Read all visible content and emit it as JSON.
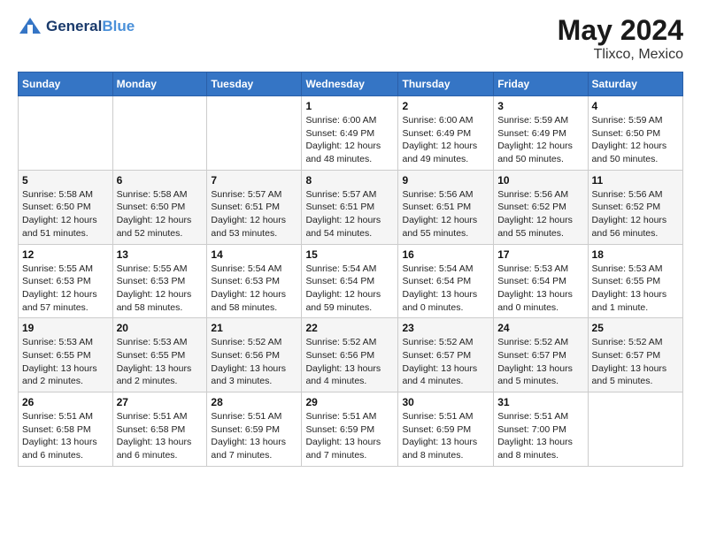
{
  "header": {
    "logo_line1": "General",
    "logo_line2": "Blue",
    "title": "May 2024",
    "subtitle": "Tlixco, Mexico"
  },
  "weekdays": [
    "Sunday",
    "Monday",
    "Tuesday",
    "Wednesday",
    "Thursday",
    "Friday",
    "Saturday"
  ],
  "weeks": [
    [
      {
        "day": "",
        "info": ""
      },
      {
        "day": "",
        "info": ""
      },
      {
        "day": "",
        "info": ""
      },
      {
        "day": "1",
        "info": "Sunrise: 6:00 AM\nSunset: 6:49 PM\nDaylight: 12 hours\nand 48 minutes."
      },
      {
        "day": "2",
        "info": "Sunrise: 6:00 AM\nSunset: 6:49 PM\nDaylight: 12 hours\nand 49 minutes."
      },
      {
        "day": "3",
        "info": "Sunrise: 5:59 AM\nSunset: 6:49 PM\nDaylight: 12 hours\nand 50 minutes."
      },
      {
        "day": "4",
        "info": "Sunrise: 5:59 AM\nSunset: 6:50 PM\nDaylight: 12 hours\nand 50 minutes."
      }
    ],
    [
      {
        "day": "5",
        "info": "Sunrise: 5:58 AM\nSunset: 6:50 PM\nDaylight: 12 hours\nand 51 minutes."
      },
      {
        "day": "6",
        "info": "Sunrise: 5:58 AM\nSunset: 6:50 PM\nDaylight: 12 hours\nand 52 minutes."
      },
      {
        "day": "7",
        "info": "Sunrise: 5:57 AM\nSunset: 6:51 PM\nDaylight: 12 hours\nand 53 minutes."
      },
      {
        "day": "8",
        "info": "Sunrise: 5:57 AM\nSunset: 6:51 PM\nDaylight: 12 hours\nand 54 minutes."
      },
      {
        "day": "9",
        "info": "Sunrise: 5:56 AM\nSunset: 6:51 PM\nDaylight: 12 hours\nand 55 minutes."
      },
      {
        "day": "10",
        "info": "Sunrise: 5:56 AM\nSunset: 6:52 PM\nDaylight: 12 hours\nand 55 minutes."
      },
      {
        "day": "11",
        "info": "Sunrise: 5:56 AM\nSunset: 6:52 PM\nDaylight: 12 hours\nand 56 minutes."
      }
    ],
    [
      {
        "day": "12",
        "info": "Sunrise: 5:55 AM\nSunset: 6:53 PM\nDaylight: 12 hours\nand 57 minutes."
      },
      {
        "day": "13",
        "info": "Sunrise: 5:55 AM\nSunset: 6:53 PM\nDaylight: 12 hours\nand 58 minutes."
      },
      {
        "day": "14",
        "info": "Sunrise: 5:54 AM\nSunset: 6:53 PM\nDaylight: 12 hours\nand 58 minutes."
      },
      {
        "day": "15",
        "info": "Sunrise: 5:54 AM\nSunset: 6:54 PM\nDaylight: 12 hours\nand 59 minutes."
      },
      {
        "day": "16",
        "info": "Sunrise: 5:54 AM\nSunset: 6:54 PM\nDaylight: 13 hours\nand 0 minutes."
      },
      {
        "day": "17",
        "info": "Sunrise: 5:53 AM\nSunset: 6:54 PM\nDaylight: 13 hours\nand 0 minutes."
      },
      {
        "day": "18",
        "info": "Sunrise: 5:53 AM\nSunset: 6:55 PM\nDaylight: 13 hours\nand 1 minute."
      }
    ],
    [
      {
        "day": "19",
        "info": "Sunrise: 5:53 AM\nSunset: 6:55 PM\nDaylight: 13 hours\nand 2 minutes."
      },
      {
        "day": "20",
        "info": "Sunrise: 5:53 AM\nSunset: 6:55 PM\nDaylight: 13 hours\nand 2 minutes."
      },
      {
        "day": "21",
        "info": "Sunrise: 5:52 AM\nSunset: 6:56 PM\nDaylight: 13 hours\nand 3 minutes."
      },
      {
        "day": "22",
        "info": "Sunrise: 5:52 AM\nSunset: 6:56 PM\nDaylight: 13 hours\nand 4 minutes."
      },
      {
        "day": "23",
        "info": "Sunrise: 5:52 AM\nSunset: 6:57 PM\nDaylight: 13 hours\nand 4 minutes."
      },
      {
        "day": "24",
        "info": "Sunrise: 5:52 AM\nSunset: 6:57 PM\nDaylight: 13 hours\nand 5 minutes."
      },
      {
        "day": "25",
        "info": "Sunrise: 5:52 AM\nSunset: 6:57 PM\nDaylight: 13 hours\nand 5 minutes."
      }
    ],
    [
      {
        "day": "26",
        "info": "Sunrise: 5:51 AM\nSunset: 6:58 PM\nDaylight: 13 hours\nand 6 minutes."
      },
      {
        "day": "27",
        "info": "Sunrise: 5:51 AM\nSunset: 6:58 PM\nDaylight: 13 hours\nand 6 minutes."
      },
      {
        "day": "28",
        "info": "Sunrise: 5:51 AM\nSunset: 6:59 PM\nDaylight: 13 hours\nand 7 minutes."
      },
      {
        "day": "29",
        "info": "Sunrise: 5:51 AM\nSunset: 6:59 PM\nDaylight: 13 hours\nand 7 minutes."
      },
      {
        "day": "30",
        "info": "Sunrise: 5:51 AM\nSunset: 6:59 PM\nDaylight: 13 hours\nand 8 minutes."
      },
      {
        "day": "31",
        "info": "Sunrise: 5:51 AM\nSunset: 7:00 PM\nDaylight: 13 hours\nand 8 minutes."
      },
      {
        "day": "",
        "info": ""
      }
    ]
  ]
}
